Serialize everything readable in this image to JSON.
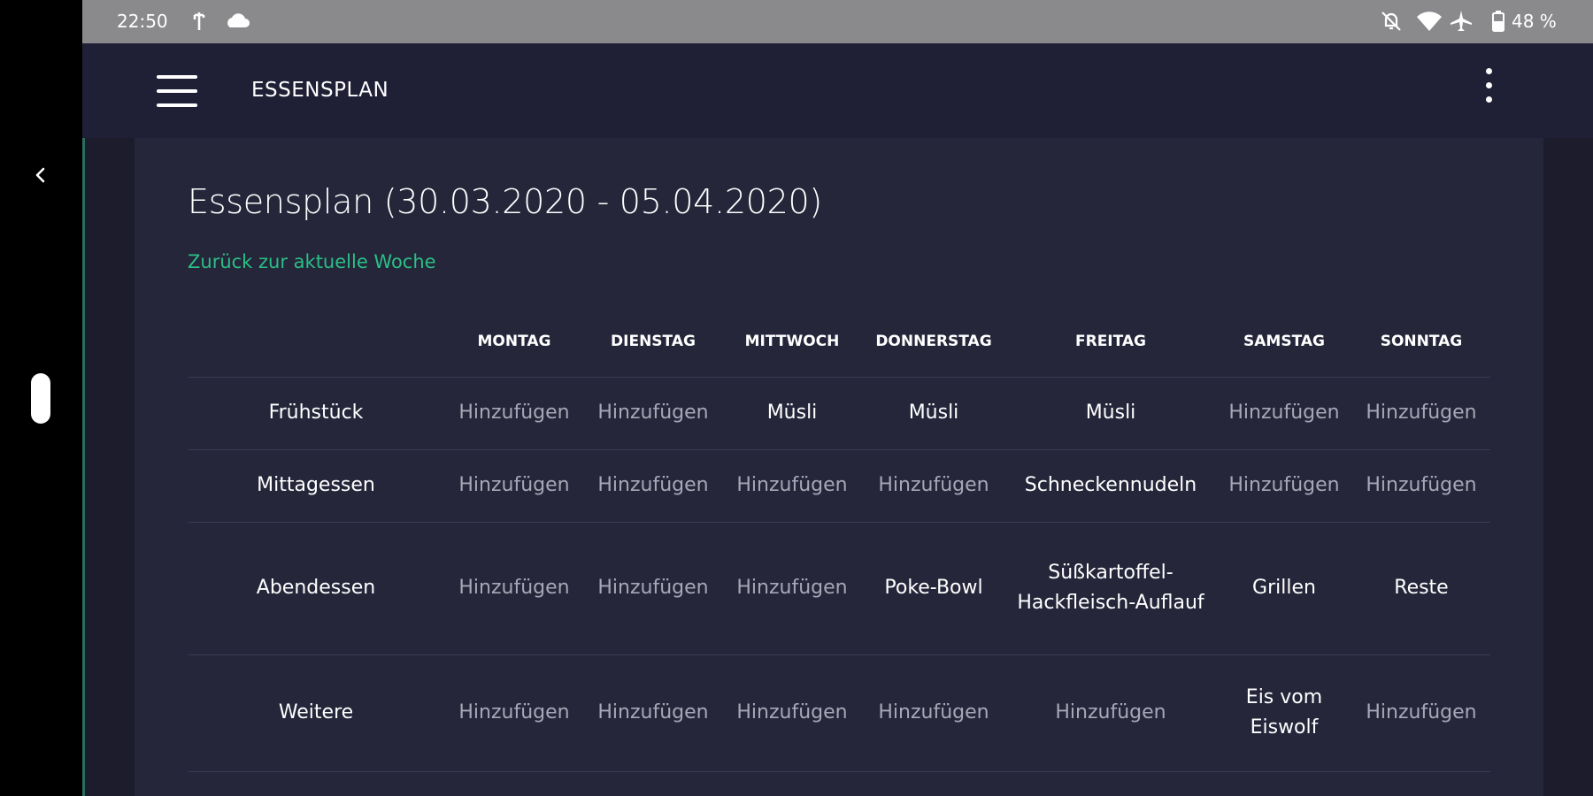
{
  "status_bar": {
    "time": "22:50",
    "battery": "48 %",
    "icons": [
      "usb-icon",
      "cloud-icon",
      "notifications-off-icon",
      "wifi-icon",
      "airplane-icon",
      "battery-icon"
    ]
  },
  "navigation_bar": {
    "icons": [
      "back-icon",
      "home-pill"
    ]
  },
  "app_bar": {
    "title": "ESSENSPLAN",
    "icons": [
      "menu-icon",
      "more-vert-icon"
    ]
  },
  "page": {
    "heading": "Essensplan (30.03.2020 - 05.04.2020)",
    "back_link": "Zurück zur aktuelle Woche"
  },
  "table": {
    "days": [
      "MONTAG",
      "DIENSTAG",
      "MITTWOCH",
      "DONNERSTAG",
      "FREITAG",
      "SAMSTAG",
      "SONNTAG"
    ],
    "rows": [
      {
        "label": "Frühstück",
        "cells": [
          {
            "text": "Hinzufügen",
            "set": false
          },
          {
            "text": "Hinzufügen",
            "set": false
          },
          {
            "text": "Müsli",
            "set": true
          },
          {
            "text": "Müsli",
            "set": true
          },
          {
            "text": "Müsli",
            "set": true
          },
          {
            "text": "Hinzufügen",
            "set": false
          },
          {
            "text": "Hinzufügen",
            "set": false
          }
        ]
      },
      {
        "label": "Mittagessen",
        "cells": [
          {
            "text": "Hinzufügen",
            "set": false
          },
          {
            "text": "Hinzufügen",
            "set": false
          },
          {
            "text": "Hinzufügen",
            "set": false
          },
          {
            "text": "Hinzufügen",
            "set": false
          },
          {
            "text": "Schneckennudeln",
            "set": true
          },
          {
            "text": "Hinzufügen",
            "set": false
          },
          {
            "text": "Hinzufügen",
            "set": false
          }
        ]
      },
      {
        "label": "Abendessen",
        "cells": [
          {
            "text": "Hinzufügen",
            "set": false
          },
          {
            "text": "Hinzufügen",
            "set": false
          },
          {
            "text": "Hinzufügen",
            "set": false
          },
          {
            "text": "Poke-Bowl",
            "set": true
          },
          {
            "text": "Süßkartoffel-Hackfleisch-Auflauf",
            "set": true
          },
          {
            "text": "Grillen",
            "set": true
          },
          {
            "text": "Reste",
            "set": true
          }
        ]
      },
      {
        "label": "Weitere",
        "cells": [
          {
            "text": "Hinzufügen",
            "set": false
          },
          {
            "text": "Hinzufügen",
            "set": false
          },
          {
            "text": "Hinzufügen",
            "set": false
          },
          {
            "text": "Hinzufügen",
            "set": false
          },
          {
            "text": "Hinzufügen",
            "set": false
          },
          {
            "text": "Eis vom Eiswolf",
            "set": true
          },
          {
            "text": "Hinzufügen",
            "set": false
          }
        ]
      }
    ]
  },
  "colors": {
    "status_bar": "#8a8a8c",
    "app_bar": "#1f1f36",
    "card": "#25263a",
    "background": "#1c1c2c",
    "link_accent": "#2bbf85",
    "placeholder_text": "#a7a7b5",
    "meal_text": "#ffffff"
  }
}
